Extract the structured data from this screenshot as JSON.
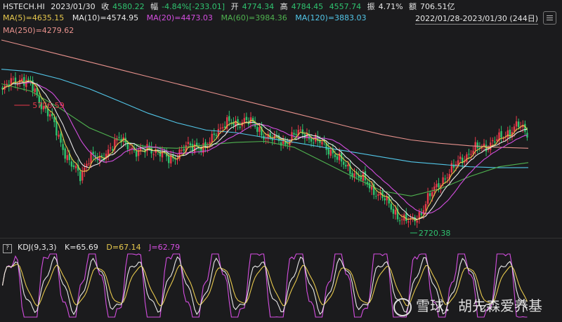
{
  "header": {
    "symbol": "HSTECH.HI",
    "date": "2023/01/30",
    "close_label": "收",
    "close_value": "4580.22",
    "change_label": "幅",
    "change_value": "-4.84%[-233.01]",
    "open_label": "开",
    "open_value": "4774.34",
    "high_label": "高",
    "high_value": "4784.45",
    "low_value": "4557.74",
    "amp_label": "振",
    "amp_value": "4.71%",
    "turnover_label": "额",
    "turnover_value": "706.51亿"
  },
  "ma": {
    "ma5": "MA(5)=4635.15",
    "ma10": "MA(10)=4574.95",
    "ma20": "MA(20)=4473.03",
    "ma60": "MA(60)=3984.36",
    "ma120": "MA(120)=3883.03",
    "ma250": "MA(250)=4279.62"
  },
  "range": "2022/01/28-2023/01/30 (244日)",
  "annotations": {
    "high": "5726.59",
    "low": "2720.38"
  },
  "kdj": {
    "help": "?",
    "title": "KDJ(9,3,3)",
    "k": "K=65.69",
    "d": "D=67.14",
    "j": "J=62.79"
  },
  "watermark": "雪球：胡先森爱养基",
  "colors": {
    "up": "#e8394a",
    "down": "#2fc36f",
    "ma5": "#e6c84d",
    "ma10": "#e8e8e8",
    "ma20": "#d44ee0",
    "ma60": "#4fb24f",
    "ma120": "#52c6e8",
    "ma250": "#e8928d",
    "bg": "#1b1b1d"
  },
  "chart_data": {
    "type": "line",
    "title": "HSTECH.HI",
    "period": "2022/01/28-2023/01/30",
    "candles_anchor_close": [
      5450,
      5650,
      5700,
      5550,
      5200,
      4900,
      4400,
      3950,
      3700,
      4150,
      4000,
      4300,
      4450,
      4350,
      4150,
      4300,
      4200,
      4050,
      4150,
      4300,
      4350,
      4250,
      4650,
      4800,
      4750,
      4900,
      4700,
      4550,
      4450,
      4400,
      4550,
      4600,
      4450,
      4350,
      4200,
      3950,
      3800,
      3650,
      3450,
      3300,
      3050,
      2850,
      2750,
      2950,
      3300,
      3600,
      3750,
      4050,
      4150,
      4300,
      4350,
      4450,
      4600,
      4750,
      4580
    ],
    "series": [
      {
        "name": "MA(250)",
        "values": [
          6500,
          6350,
          6200,
          6050,
          5900,
          5750,
          5600,
          5450,
          5300,
          5150,
          5000,
          4850,
          4700,
          4560,
          4450,
          4380,
          4330,
          4300,
          4280
        ]
      },
      {
        "name": "MA(120)",
        "values": [
          5900,
          5850,
          5700,
          5500,
          5250,
          5000,
          4800,
          4650,
          4600,
          4500,
          4400,
          4300,
          4200,
          4100,
          4000,
          3950,
          3900,
          3880,
          3883
        ]
      },
      {
        "name": "MA(60)",
        "values": [
          5600,
          5450,
          5100,
          4700,
          4450,
          4300,
          4280,
          4350,
          4400,
          4420,
          4300,
          4000,
          3700,
          3400,
          3300,
          3450,
          3700,
          3900,
          3984
        ]
      }
    ],
    "kdj_panel": {
      "k": 65.69,
      "d": 67.14,
      "j": 62.79,
      "ylim": [
        0,
        100
      ]
    }
  }
}
